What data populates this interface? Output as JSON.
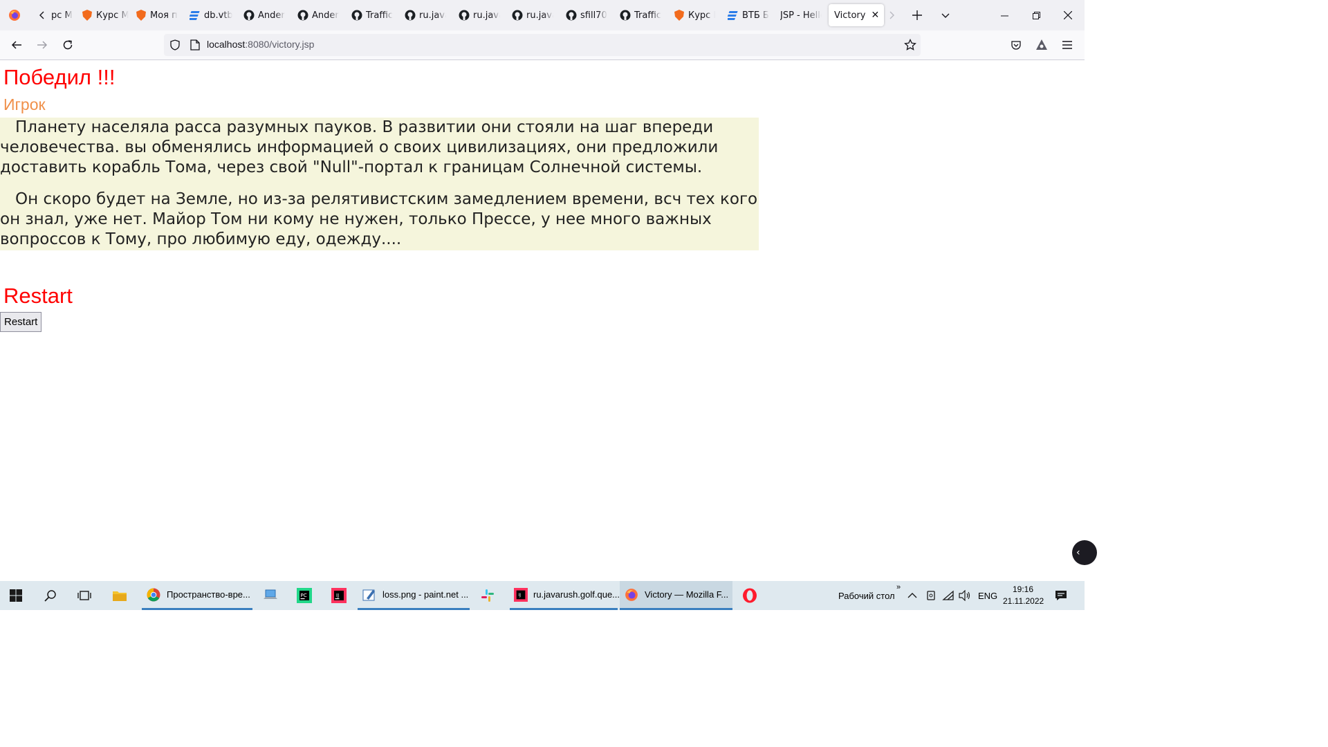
{
  "browser": {
    "tabs": [
      {
        "title": "рс М",
        "icon": "chevron-left-icon"
      },
      {
        "title": "Курс М",
        "icon": "shield-icon"
      },
      {
        "title": "Моя п",
        "icon": "shield-icon"
      },
      {
        "title": "db.vtb",
        "icon": "stack-icon"
      },
      {
        "title": "Ander",
        "icon": "github-icon"
      },
      {
        "title": "Ander",
        "icon": "github-icon"
      },
      {
        "title": "Traffic",
        "icon": "github-icon"
      },
      {
        "title": "ru.java",
        "icon": "github-icon"
      },
      {
        "title": "ru.java",
        "icon": "github-icon"
      },
      {
        "title": "ru.java",
        "icon": "github-icon"
      },
      {
        "title": "sfill70",
        "icon": "github-icon"
      },
      {
        "title": "Traffic",
        "icon": "github-icon"
      },
      {
        "title": "Курс М",
        "icon": "shield-icon"
      },
      {
        "title": "ВТБ Б",
        "icon": "stack-icon"
      },
      {
        "title": "JSP - Hello",
        "icon": ""
      }
    ],
    "active_tab": {
      "title": "Victory"
    },
    "url": {
      "host": "localhost",
      "path": ":8080/victory.jsp"
    }
  },
  "page": {
    "heading": "Победил !!!",
    "player": "Игрок",
    "story": [
      "Планету населяла расса разумных пауков. В развитии они стояли на шаг впереди человечества. вы обменялись информацией о своих цивилизациях, они предложили доставить корабль Тома, через свой \"Null\"-портал к границам Солнечной системы.",
      "Он скоро будет на Земле, но из-за релятивистским замедлением времени, всч тех кого он знал, уже нет. Майор Том ни кому не нужен, только Прессе, у нее много важных вопроссов к Тому, про любимую еду, одежду...."
    ],
    "restart_heading": "Restart",
    "restart_button": "Restart"
  },
  "taskbar": {
    "apps": [
      {
        "label": "Пространство-вре...",
        "icon": "chrome-icon"
      },
      {
        "label": "loss.png - paint.net ...",
        "icon": "paintnet-icon"
      },
      {
        "label": "ru.javarush.golf.que...",
        "icon": "intellij-icon"
      },
      {
        "label": "Victory — Mozilla F...",
        "icon": "firefox-icon"
      }
    ],
    "desktop_label": "Рабочий стол",
    "lang": "ENG",
    "time": "19:16",
    "date": "21.11.2022"
  },
  "colors": {
    "heading": "#ff0000",
    "player": "#f0904a",
    "story_bg": "#f5f5dc"
  }
}
